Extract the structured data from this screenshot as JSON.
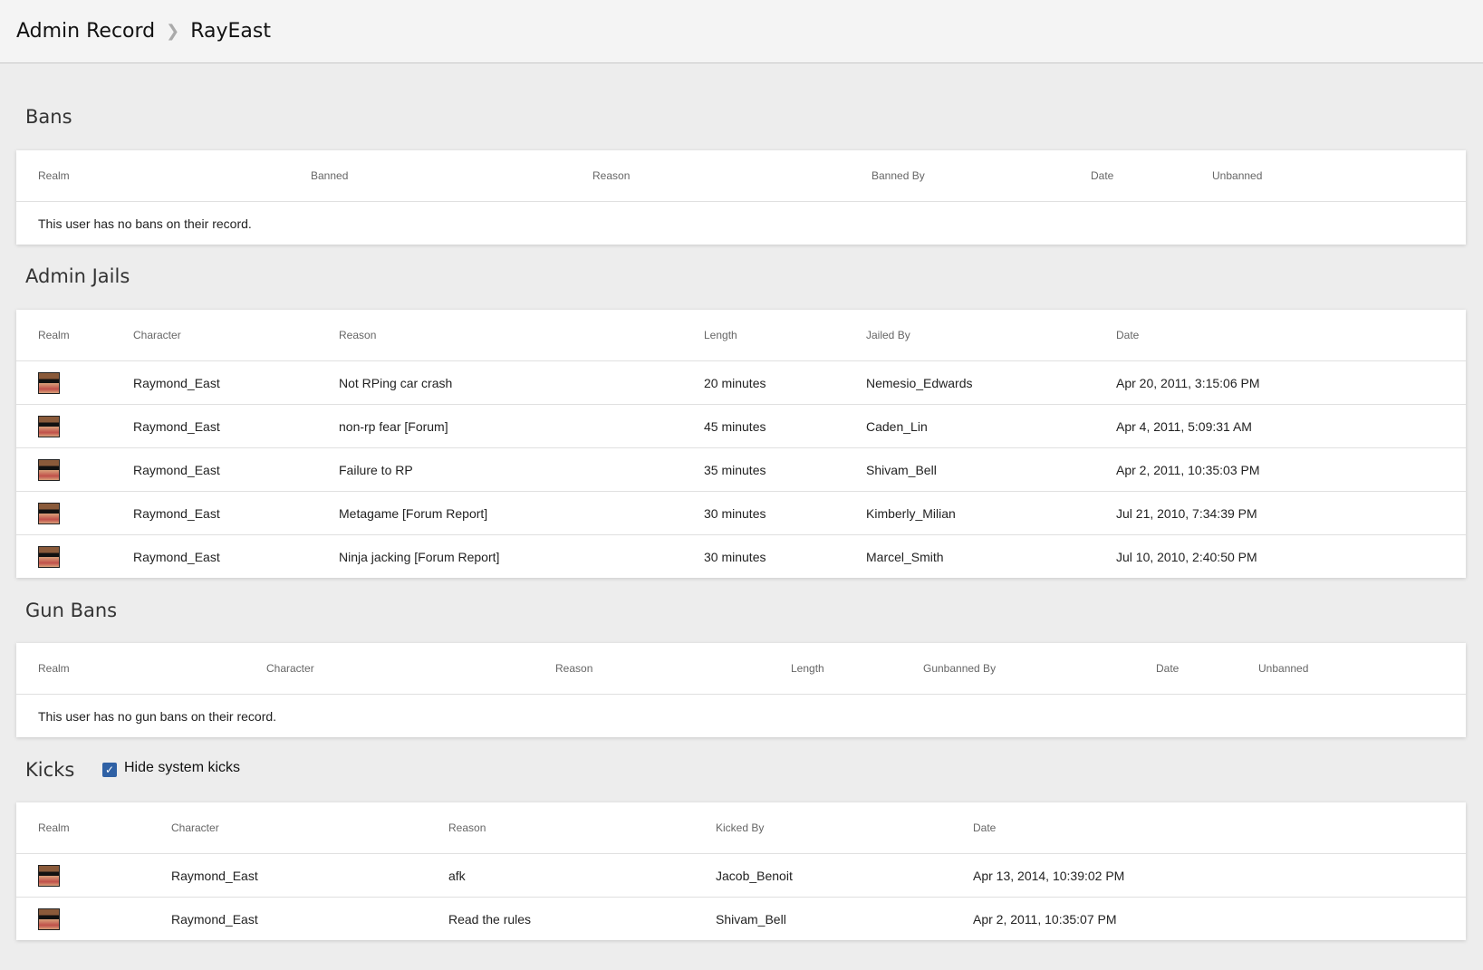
{
  "breadcrumb": {
    "root": "Admin Record",
    "current": "RayEast"
  },
  "bans": {
    "title": "Bans",
    "columns": [
      "Realm",
      "Banned",
      "Reason",
      "Banned By",
      "Date",
      "Unbanned"
    ],
    "empty": "This user has no bans on their record."
  },
  "jails": {
    "title": "Admin Jails",
    "columns": [
      "Realm",
      "Character",
      "Reason",
      "Length",
      "Jailed By",
      "Date"
    ],
    "rows": [
      [
        "Raymond_East",
        "Not RPing car crash",
        "20 minutes",
        "Nemesio_Edwards",
        "Apr 20, 2011, 3:15:06 PM"
      ],
      [
        "Raymond_East",
        "non-rp fear [Forum]",
        "45 minutes",
        "Caden_Lin",
        "Apr 4, 2011, 5:09:31 AM"
      ],
      [
        "Raymond_East",
        "Failure to RP",
        "35 minutes",
        "Shivam_Bell",
        "Apr 2, 2011, 10:35:03 PM"
      ],
      [
        "Raymond_East",
        "Metagame [Forum Report]",
        "30 minutes",
        "Kimberly_Milian",
        "Jul 21, 2010, 7:34:39 PM"
      ],
      [
        "Raymond_East",
        "Ninja jacking [Forum Report]",
        "30 minutes",
        "Marcel_Smith",
        "Jul 10, 2010, 2:40:50 PM"
      ]
    ]
  },
  "gunbans": {
    "title": "Gun Bans",
    "columns": [
      "Realm",
      "Character",
      "Reason",
      "Length",
      "Gunbanned By",
      "Date",
      "Unbanned"
    ],
    "empty": "This user has no gun bans on their record."
  },
  "kicks": {
    "title": "Kicks",
    "hide_system_label": "Hide system kicks",
    "hide_system_checked": true,
    "columns": [
      "Realm",
      "Character",
      "Reason",
      "Kicked By",
      "Date"
    ],
    "rows": [
      [
        "Raymond_East",
        "afk",
        "Jacob_Benoit",
        "Apr 13, 2014, 10:39:02 PM"
      ],
      [
        "Raymond_East",
        "Read the rules",
        "Shivam_Bell",
        "Apr 2, 2011, 10:35:07 PM"
      ]
    ]
  }
}
